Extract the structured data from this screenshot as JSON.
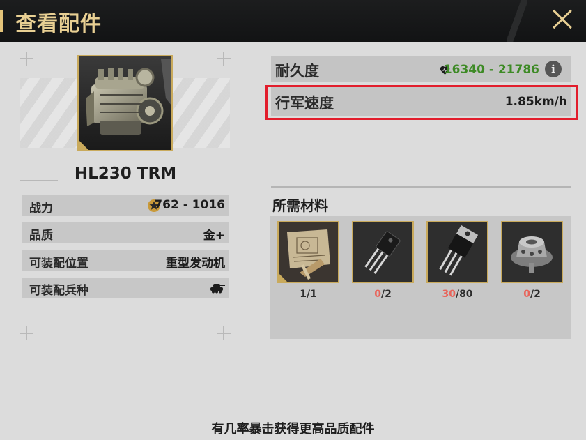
{
  "header": {
    "title": "查看配件"
  },
  "item": {
    "name": "HL230 TRM",
    "image_icon": "engine-icon",
    "stats": [
      {
        "label": "战力",
        "value": "762 - 1016",
        "icon": "star-badge-icon"
      },
      {
        "label": "品质",
        "value": "金+"
      },
      {
        "label": "可装配位置",
        "value": "重型发动机"
      },
      {
        "label": "可装配兵种",
        "value": "",
        "icon": "tank-icon"
      }
    ]
  },
  "attributes": [
    {
      "label": "耐久度",
      "value": "16340 - 21786",
      "value_color": "#3d8a25",
      "icon": "heart-icon",
      "info_icon": "info-icon"
    },
    {
      "label": "行军速度",
      "value": "1.85km/h",
      "highlighted": true
    }
  ],
  "materials": {
    "title": "所需材料",
    "items": [
      {
        "icon": "blueprint-icon",
        "have": "1",
        "need": "1",
        "insufficient": false
      },
      {
        "icon": "transistor-icon",
        "have": "0",
        "need": "2",
        "insufficient": true
      },
      {
        "icon": "power-transistor-icon",
        "have": "30",
        "need": "80",
        "insufficient": true
      },
      {
        "icon": "differential-gear-icon",
        "have": "0",
        "need": "2",
        "insufficient": true
      }
    ]
  },
  "footer": {
    "text": "有几率暴击获得更高品质配件"
  },
  "colors": {
    "accent_gold": "#c9aa5c",
    "header_text": "#e8cf93",
    "highlight_red": "#e21d2c",
    "durability_green": "#3d8a25",
    "insufficient_red": "#e8645a"
  }
}
